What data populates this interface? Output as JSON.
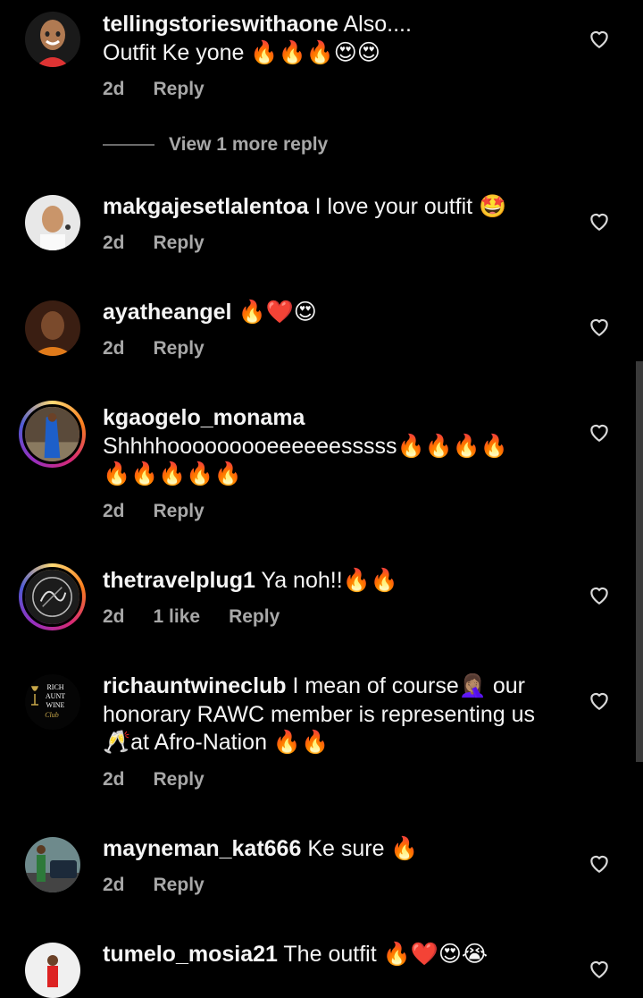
{
  "comments": [
    {
      "username": "tellingstorieswithaone",
      "text": " Also....",
      "line2": "Outfit Ke yone 🔥🔥🔥😍😍",
      "age": "2d",
      "reply": "Reply"
    },
    {
      "username": "makgajesetlalentoa",
      "text": " I love your outfit 🤩",
      "age": "2d",
      "reply": "Reply"
    },
    {
      "username": "ayatheangel",
      "text": " 🔥❤️😍",
      "age": "2d",
      "reply": "Reply"
    },
    {
      "username": "kgaogelo_monama",
      "text": "",
      "line2": "Shhhhooooooooeeeeeesssss🔥🔥🔥🔥",
      "line3": "🔥🔥🔥🔥🔥",
      "age": "2d",
      "reply": "Reply"
    },
    {
      "username": "thetravelplug1",
      "text": " Ya noh!!🔥🔥",
      "age": "2d",
      "likes": "1 like",
      "reply": "Reply"
    },
    {
      "username": "richauntwineclub",
      "text": " I mean of course🤦🏽‍♀️ our",
      "line2": "honorary RAWC member is representing us",
      "line3": "🥂at Afro-Nation 🔥🔥",
      "age": "2d",
      "reply": "Reply",
      "avatar_text": "RICH AUNT WINE Club"
    },
    {
      "username": "mayneman_kat666",
      "text": " Ke sure 🔥",
      "age": "2d",
      "reply": "Reply"
    },
    {
      "username": "tumelo_mosia21",
      "text": " The outfit 🔥❤️😍😭"
    }
  ],
  "view_more": "View 1 more reply",
  "colors": {
    "background": "#000000",
    "text": "#f5f5f5",
    "secondary": "#a8a8a8"
  }
}
